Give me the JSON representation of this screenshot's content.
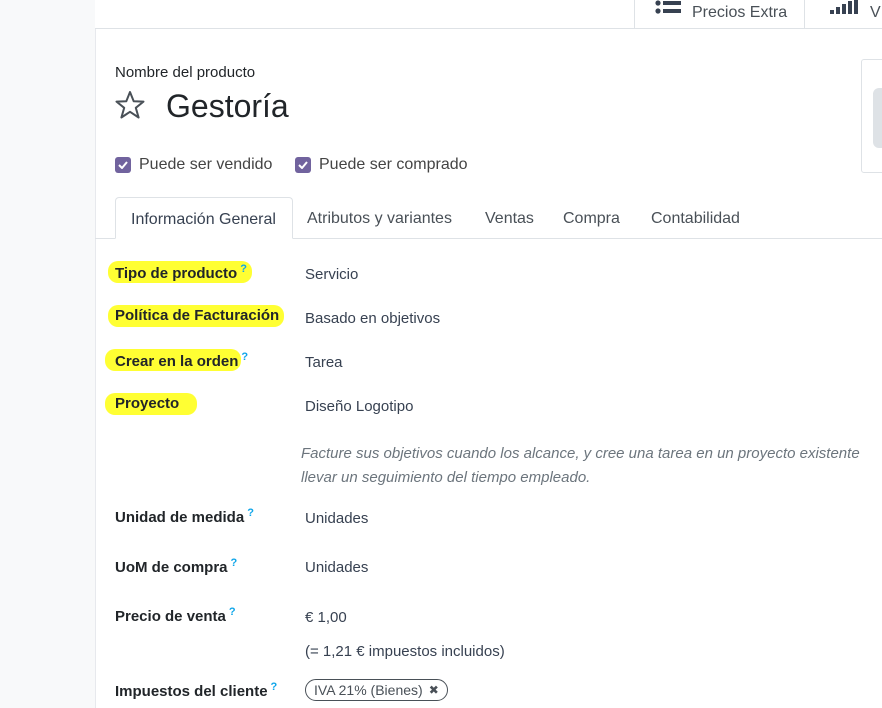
{
  "stat_buttons": {
    "precios_extra": "Precios Extra",
    "v": "V"
  },
  "product": {
    "name_label": "Nombre del producto",
    "name": "Gestoría"
  },
  "checkboxes": {
    "sale_ok": "Puede ser vendido",
    "purchase_ok": "Puede ser comprado"
  },
  "tabs": [
    {
      "label": "Información General"
    },
    {
      "label": "Atributos y variantes"
    },
    {
      "label": "Ventas"
    },
    {
      "label": "Compra"
    },
    {
      "label": "Contabilidad"
    }
  ],
  "fields": {
    "tipo_producto": {
      "label": "Tipo de producto",
      "help": "?",
      "value": "Servicio"
    },
    "politica": {
      "label": "Política de Facturación",
      "value": "Basado en objetivos"
    },
    "crear_orden": {
      "label": "Crear en la orden",
      "help": "?",
      "value": "Tarea"
    },
    "proyecto": {
      "label": "Proyecto",
      "value": "Diseño Logotipo"
    },
    "help_line1": "Facture sus objetivos cuando los alcance, y cree una tarea en un proyecto existente",
    "help_line2": "llevar un seguimiento del tiempo empleado.",
    "unidad": {
      "label": "Unidad de medida",
      "help": "?",
      "value": "Unidades"
    },
    "uom_compra": {
      "label": "UoM de compra",
      "help": "?",
      "value": "Unidades"
    },
    "precio": {
      "label": "Precio de venta",
      "help": "?",
      "value": "€ 1,00",
      "tax_included": "(= 1,21 € impuestos incluidos)"
    },
    "impuestos": {
      "label": "Impuestos del cliente",
      "help": "?",
      "tag": "IVA 21% (Bienes)"
    }
  },
  "colors": {
    "highlight": "#ffff33",
    "checkbox": "#71639e",
    "help_mark": "#0ea5e9"
  }
}
